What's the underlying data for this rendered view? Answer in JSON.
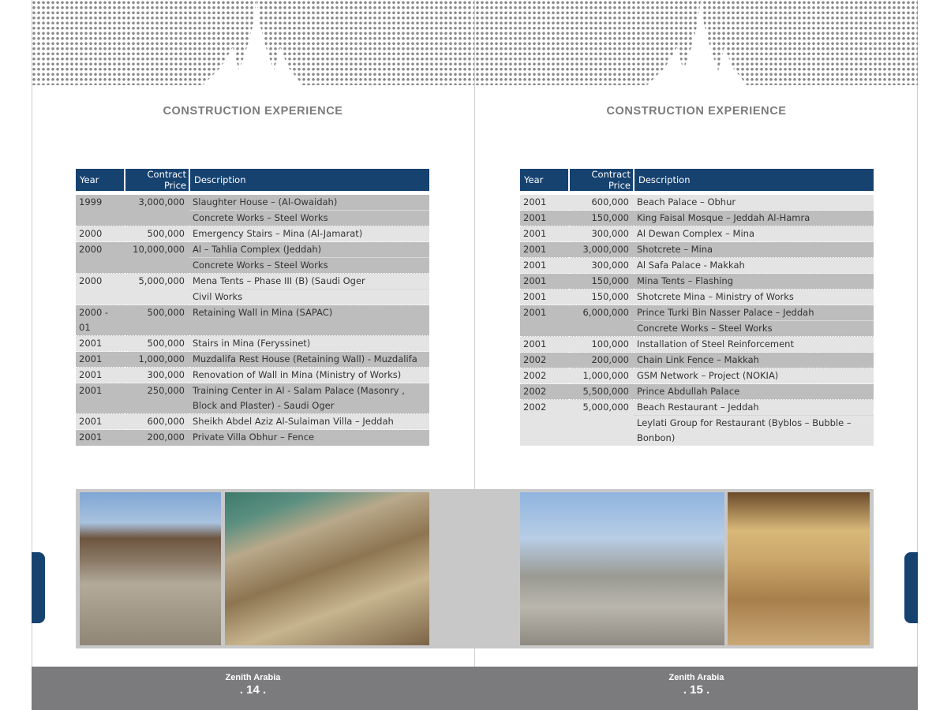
{
  "pages": [
    {
      "title": "CONSTRUCTION EXPERIENCE",
      "brand": "Zenith Arabia",
      "page_number": ". 14 .",
      "headers": {
        "year": "Year",
        "price": "Contract Price",
        "description": "Description"
      },
      "rows": [
        {
          "year": "1999",
          "price": "3,000,000",
          "desc": [
            "Slaughter House – (Al-Owaidah)",
            "Concrete Works – Steel Works"
          ]
        },
        {
          "year": "2000",
          "price": "500,000",
          "desc": [
            "Emergency Stairs – Mina (Al-Jamarat)"
          ]
        },
        {
          "year": "2000",
          "price": "10,000,000",
          "desc": [
            "Al – Tahlia Complex (Jeddah)",
            "Concrete Works – Steel Works"
          ]
        },
        {
          "year": "2000",
          "price": "5,000,000",
          "desc": [
            "Mena Tents – Phase III (B) (Saudi Oger",
            "Civil Works"
          ]
        },
        {
          "year": "2000 - 01",
          "price": "500,000",
          "desc": [
            "Retaining Wall in Mina (SAPAC)"
          ]
        },
        {
          "year": "2001",
          "price": "500,000",
          "desc": [
            "Stairs in Mina (Feryssinet)"
          ]
        },
        {
          "year": "2001",
          "price": "1,000,000",
          "desc": [
            "Muzdalifa Rest House (Retaining Wall) - Muzdalifa"
          ]
        },
        {
          "year": "2001",
          "price": "300,000",
          "desc": [
            "Renovation of Wall in Mina  (Ministry of Works)"
          ]
        },
        {
          "year": "2001",
          "price": "250,000",
          "desc": [
            "Training Center in Al - Salam Palace (Masonry , Block and Plaster) - Saudi Oger"
          ]
        },
        {
          "year": "2001",
          "price": "600,000",
          "desc": [
            "Sheikh Abdel Aziz Al-Sulaiman Villa – Jeddah"
          ]
        },
        {
          "year": "2001",
          "price": "200,000",
          "desc": [
            "Private Villa Obhur – Fence"
          ]
        }
      ]
    },
    {
      "title": "CONSTRUCTION EXPERIENCE",
      "brand": "Zenith Arabia",
      "page_number": ". 15 .",
      "headers": {
        "year": "Year",
        "price": "Contract Price",
        "description": "Description"
      },
      "rows": [
        {
          "year": "2001",
          "price": "600,000",
          "desc": [
            "Beach Palace – Obhur"
          ]
        },
        {
          "year": "2001",
          "price": "150,000",
          "desc": [
            "King Faisal Mosque – Jeddah Al-Hamra"
          ]
        },
        {
          "year": "2001",
          "price": "300,000",
          "desc": [
            "Al Dewan Complex – Mina"
          ]
        },
        {
          "year": "2001",
          "price": "3,000,000",
          "desc": [
            "Shotcrete – Mina"
          ]
        },
        {
          "year": "2001",
          "price": "300,000",
          "desc": [
            "Al Safa Palace - Makkah"
          ]
        },
        {
          "year": "2001",
          "price": "150,000",
          "desc": [
            "Mina Tents – Flashing"
          ]
        },
        {
          "year": "2001",
          "price": "150,000",
          "desc": [
            "Shotcrete Mina – Ministry of  Works"
          ]
        },
        {
          "year": "2001",
          "price": "6,000,000",
          "desc": [
            "Prince Turki Bin Nasser Palace – Jeddah",
            "Concrete Works – Steel Works"
          ]
        },
        {
          "year": "2001",
          "price": "100,000",
          "desc": [
            "Installation of  Steel Reinforcement"
          ]
        },
        {
          "year": "2002",
          "price": "200,000",
          "desc": [
            "Chain Link Fence – Makkah"
          ]
        },
        {
          "year": "2002",
          "price": "1,000,000",
          "desc": [
            "GSM Network – Project (NOKIA)"
          ]
        },
        {
          "year": "2002",
          "price": "5,500,000",
          "desc": [
            "Prince Abdullah Palace"
          ]
        },
        {
          "year": "2002",
          "price": "5,000,000",
          "desc": [
            "Beach Restaurant – Jeddah",
            "Leylati Group for Restaurant (Byblos – Bubble – Bonbon)"
          ]
        }
      ]
    }
  ],
  "colors": {
    "accent": "#164270",
    "row_dark": "#bdbdbd",
    "row_light": "#e4e4e5",
    "footer": "#7b7b7d"
  }
}
